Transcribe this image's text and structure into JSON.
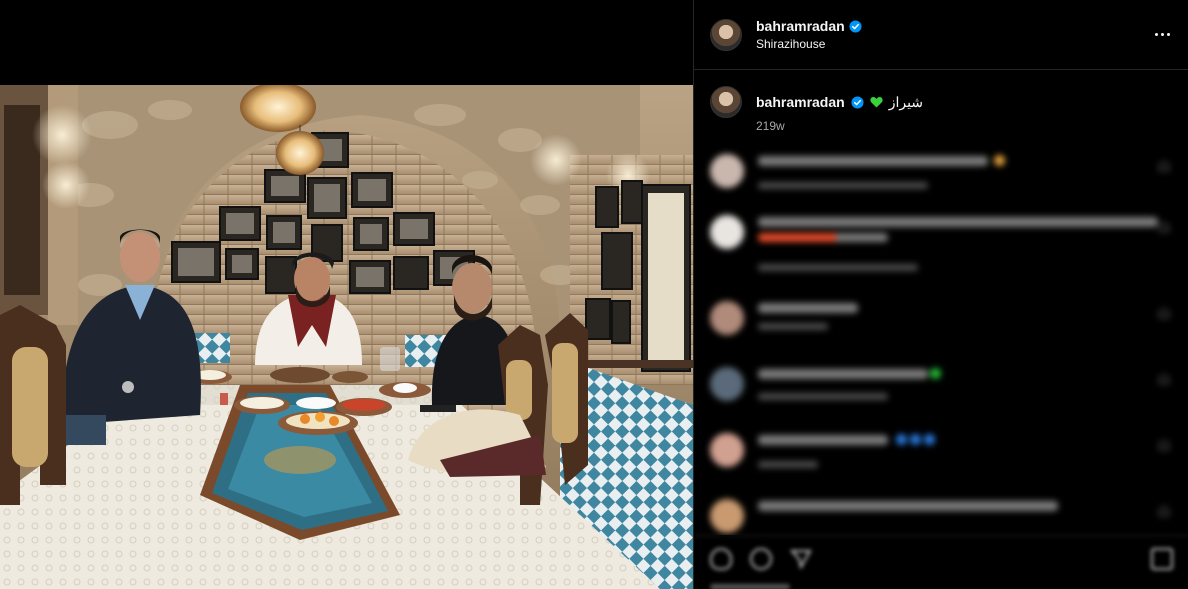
{
  "post": {
    "author": {
      "username": "bahramradan",
      "verified": true,
      "avatar_icon": "avatar-icon"
    },
    "location": "Shirazihouse",
    "more_icon": "more-options-icon",
    "caption": {
      "username": "bahramradan",
      "text": "شیراز",
      "emoji": "green-heart-icon",
      "time": "219w"
    }
  },
  "colors": {
    "background": "#000000",
    "text_primary": "#f5f5f5",
    "text_secondary": "#a8a8a8",
    "divider": "#262626",
    "verified_blue": "#0095f6",
    "green_heart": "#3ad23a"
  },
  "comments": {
    "blurred": true,
    "count_visible": 8
  },
  "actions": {
    "icons": [
      "heart-icon",
      "comment-icon",
      "share-icon",
      "save-icon"
    ]
  }
}
